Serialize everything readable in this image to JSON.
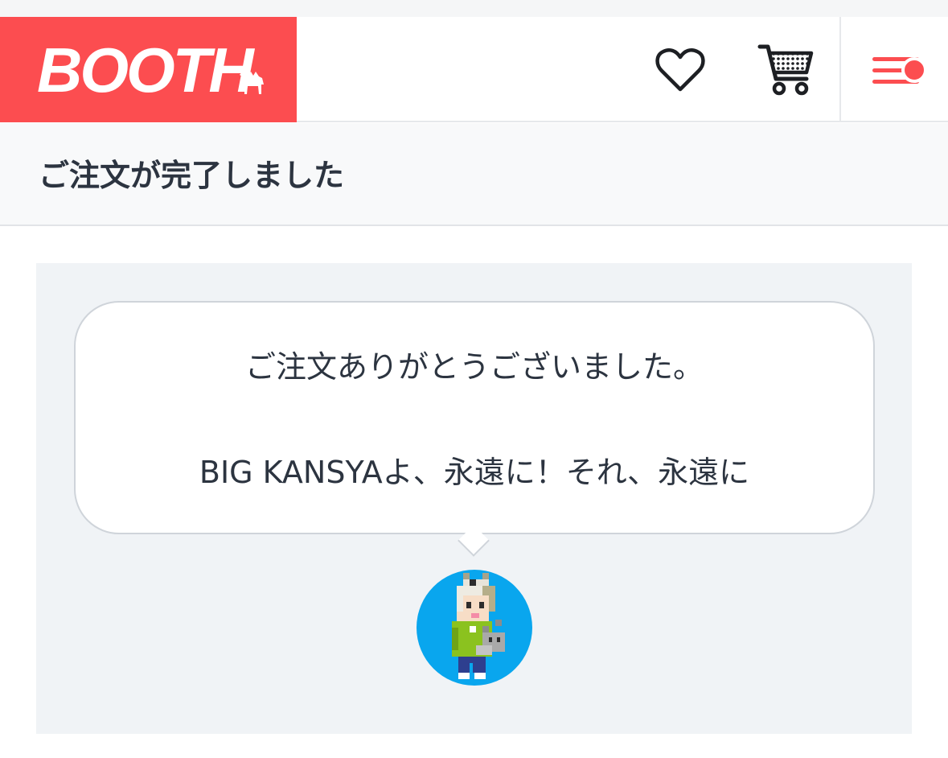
{
  "header": {
    "logo_text": "BOOTH",
    "logo_mark": "camel-icon",
    "icons": [
      "heart-icon",
      "cart-icon",
      "menu-icon"
    ],
    "has_notification": true
  },
  "page": {
    "title": "ご注文が完了しました"
  },
  "message": {
    "line1": "ご注文ありがとうございました。",
    "line2": "BIG KANSYAよ、永遠に！それ、永遠に"
  },
  "colors": {
    "brand": "#fc4d50",
    "avatar_bg": "#09a6ee",
    "panel_bg": "#f0f3f6"
  }
}
